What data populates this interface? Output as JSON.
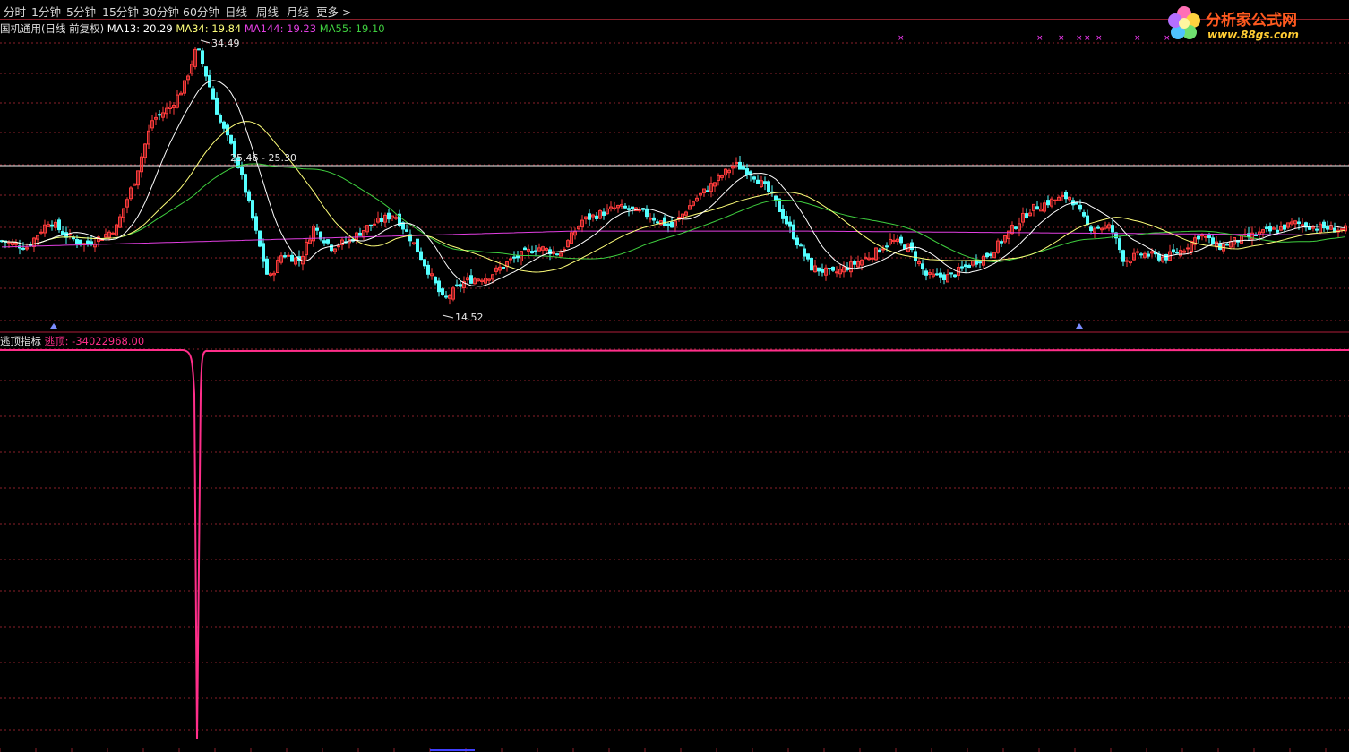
{
  "toolbar": {
    "tabs": [
      {
        "label": "分时",
        "active": true
      },
      {
        "label": "1分钟",
        "active": false
      },
      {
        "label": "5分钟",
        "active": false
      },
      {
        "label": "15分钟",
        "active": false
      },
      {
        "label": "30分钟",
        "active": false
      },
      {
        "label": "60分钟",
        "active": false
      },
      {
        "label": "日线",
        "active": false
      },
      {
        "label": "周线",
        "active": false
      },
      {
        "label": "月线",
        "active": false
      },
      {
        "label": "更多 >",
        "active": false
      }
    ]
  },
  "logo": {
    "title": "分析家公式网",
    "url": "www.88gs.com"
  },
  "main_legend": {
    "name": "国机通用(日线 前复权)",
    "ma13": "MA13: 20.29",
    "ma34": "MA34: 19.84",
    "ma144": "MA144: 19.23",
    "ma55": "MA55: 19.10"
  },
  "price_labels": {
    "high": "34.49",
    "low": "14.52",
    "hline": "25.46 - 25.30"
  },
  "indicator_legend": {
    "name": "逃顶指标",
    "series": "逃顶: -34022968.00"
  },
  "colors": {
    "up": "#ff3b3b",
    "down": "#54ffff",
    "ma13": "#ffffff",
    "ma34": "#ffff7a",
    "ma55": "#3fcf3f",
    "ma144": "#e23fe2",
    "grid": "#8a1f2a",
    "indicator": "#ff2e8a",
    "tab_active": "#2aa6ff"
  },
  "chart_data": [
    {
      "type": "candlestick",
      "title": "国机通用(日线 前复权)",
      "series": [
        {
          "name": "MA13",
          "last": 20.29
        },
        {
          "name": "MA34",
          "last": 19.84
        },
        {
          "name": "MA144",
          "last": 19.23
        },
        {
          "name": "MA55",
          "last": 19.1
        }
      ],
      "annotations": {
        "high": 34.49,
        "low": 14.52,
        "hline": [
          25.46,
          25.3
        ]
      },
      "ylim": [
        13.5,
        35.5
      ],
      "grid": true
    },
    {
      "type": "line",
      "title": "逃顶指标",
      "series": [
        {
          "name": "逃顶",
          "last": -34022968.0
        }
      ],
      "grid": true
    }
  ]
}
